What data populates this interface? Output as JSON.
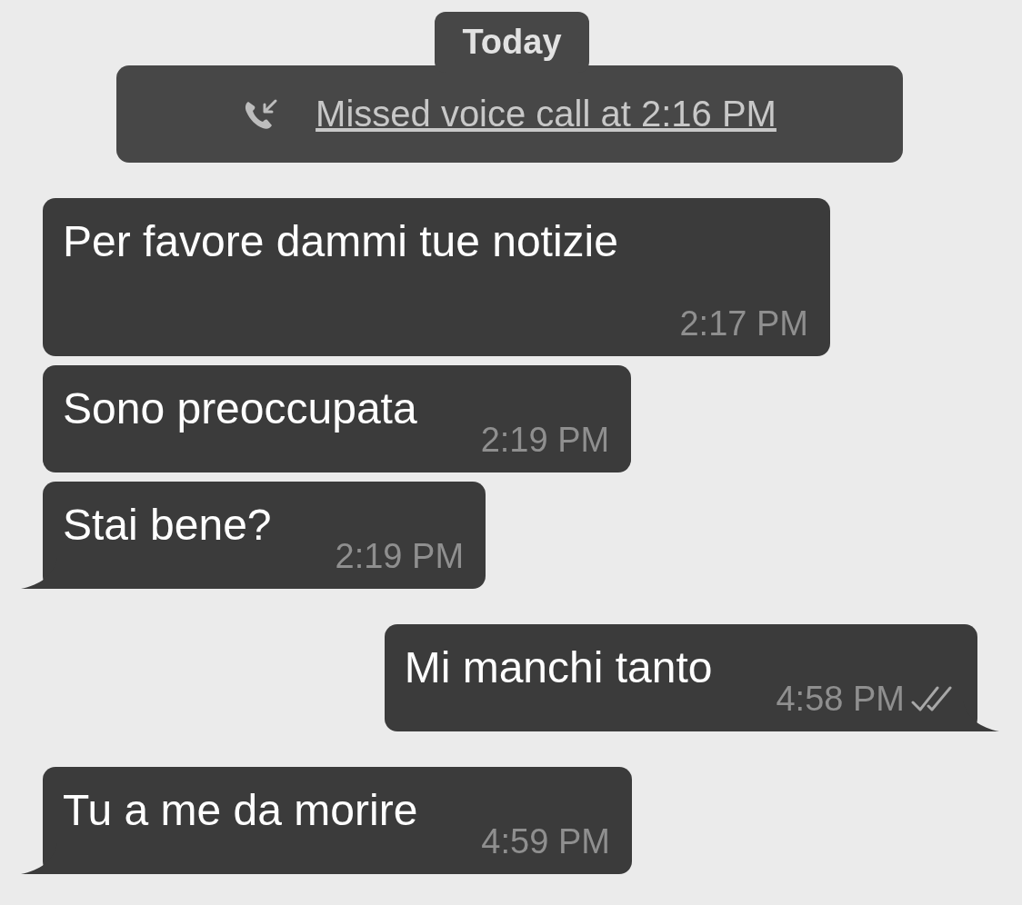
{
  "date_label": "Today",
  "missed_call": {
    "text": "Missed voice call at 2:16 PM"
  },
  "messages": [
    {
      "kind": "incoming",
      "text": "Per favore dammi tue notizie",
      "time": "2:17 PM",
      "tail": false
    },
    {
      "kind": "incoming",
      "text": "Sono preoccupata",
      "time": "2:19 PM",
      "tail": false
    },
    {
      "kind": "incoming",
      "text": "Stai bene?",
      "time": "2:19 PM",
      "tail": true
    },
    {
      "kind": "outgoing",
      "text": "Mi manchi tanto",
      "time": "4:58 PM",
      "tail": true,
      "read": true
    },
    {
      "kind": "incoming",
      "text": "Tu a me da morire",
      "time": "4:59 PM",
      "tail": true
    }
  ]
}
